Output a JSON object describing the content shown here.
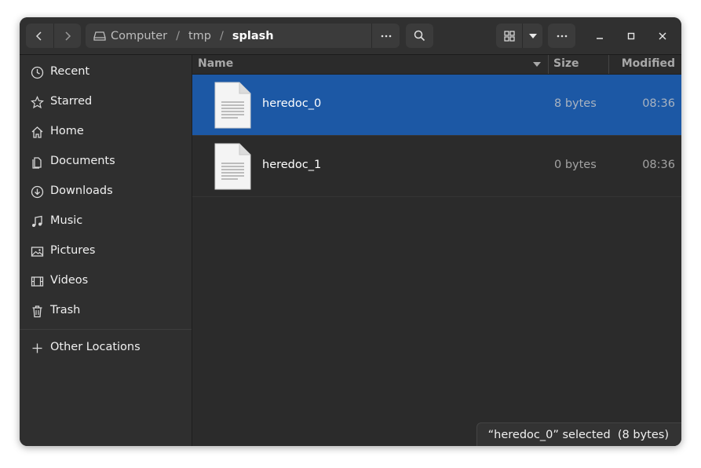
{
  "path": {
    "crumbs": [
      {
        "label": "Computer",
        "icon": "drive-icon"
      },
      {
        "label": "tmp"
      },
      {
        "label": "splash"
      }
    ]
  },
  "sidebar": {
    "items": [
      {
        "label": "Recent",
        "icon": "clock-icon"
      },
      {
        "label": "Starred",
        "icon": "star-icon"
      },
      {
        "label": "Home",
        "icon": "home-icon"
      },
      {
        "label": "Documents",
        "icon": "document-icon"
      },
      {
        "label": "Downloads",
        "icon": "download-icon"
      },
      {
        "label": "Music",
        "icon": "music-icon"
      },
      {
        "label": "Pictures",
        "icon": "picture-icon"
      },
      {
        "label": "Videos",
        "icon": "video-icon"
      },
      {
        "label": "Trash",
        "icon": "trash-icon"
      }
    ],
    "other": {
      "label": "Other Locations",
      "icon": "plus-icon"
    }
  },
  "columns": {
    "name": "Name",
    "size": "Size",
    "modified": "Modified"
  },
  "files": [
    {
      "name": "heredoc_0",
      "size": "8 bytes",
      "modified": "08:36",
      "selected": true
    },
    {
      "name": "heredoc_1",
      "size": "0 bytes",
      "modified": "08:36",
      "selected": false
    }
  ],
  "status": {
    "text": "“heredoc_0” selected  (8 bytes)"
  },
  "colors": {
    "selection": "#1c58a5",
    "window_bg": "#2a2a2a",
    "sidebar_bg": "#2f2f2f"
  }
}
